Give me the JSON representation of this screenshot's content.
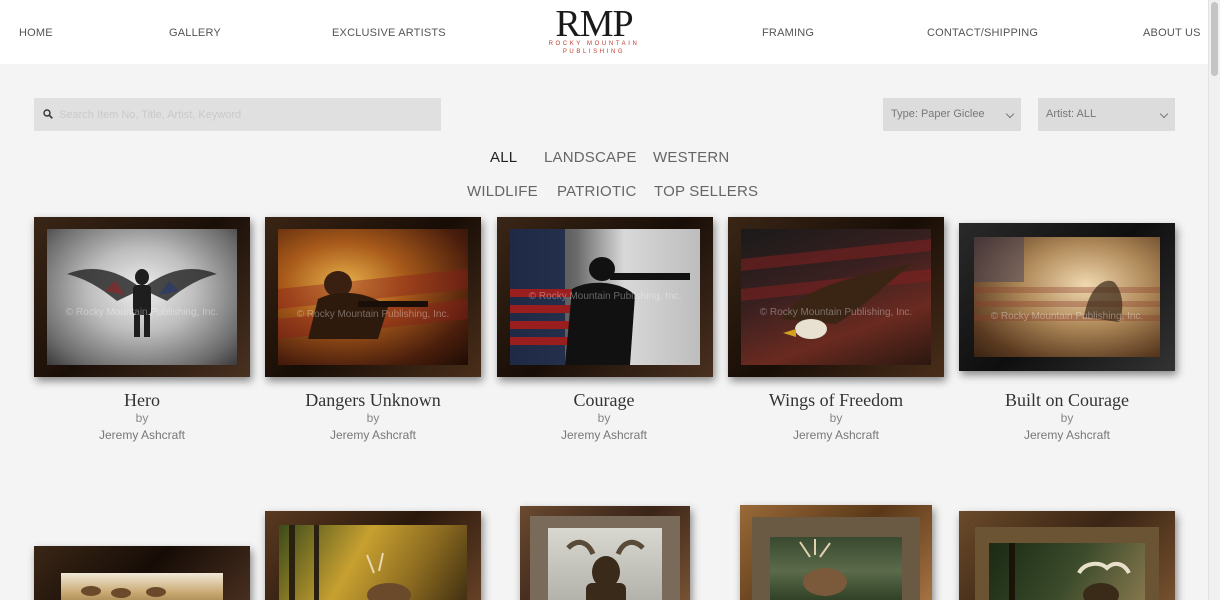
{
  "nav": {
    "home": "HOME",
    "gallery": "GALLERY",
    "exclusive": "EXCLUSIVE ARTISTS",
    "framing": "FRAMING",
    "contact": "CONTACT/SHIPPING",
    "about": "ABOUT US"
  },
  "logo": {
    "main": "RMP",
    "sub_1": "ROCKY MOUNTAIN",
    "sub_2": "PUBLISHING"
  },
  "search": {
    "placeholder": "Search Item No, Title, Artist, Keyword"
  },
  "filters": {
    "type": "Type: Paper Giclee",
    "artist": "Artist: ALL"
  },
  "categories": [
    "ALL",
    "LANDSCAPE",
    "WESTERN",
    "WILDLIFE",
    "PATRIOTIC",
    "TOP SELLERS"
  ],
  "watermark": "© Rocky Mountain Publishing, Inc.",
  "products": [
    {
      "title": "Hero",
      "by": "by",
      "artist": "Jeremy Ashcraft",
      "icon": "soldier-angel-icon"
    },
    {
      "title": "Dangers Unknown",
      "by": "by",
      "artist": "Jeremy Ashcraft",
      "icon": "soldier-flames-icon"
    },
    {
      "title": "Courage",
      "by": "by",
      "artist": "Jeremy Ashcraft",
      "icon": "soldier-flag-icon"
    },
    {
      "title": "Wings of Freedom",
      "by": "by",
      "artist": "Jeremy Ashcraft",
      "icon": "eagle-icon"
    },
    {
      "title": "Built on Courage",
      "by": "by",
      "artist": "Jeremy Ashcraft",
      "icon": "flag-monument-icon"
    }
  ],
  "second_row": [
    {
      "icon": "elk-herd-icon"
    },
    {
      "icon": "elk-forest-icon"
    },
    {
      "icon": "moose-icon"
    },
    {
      "icon": "elk-bugling-icon"
    },
    {
      "icon": "moose-forest-icon"
    }
  ]
}
